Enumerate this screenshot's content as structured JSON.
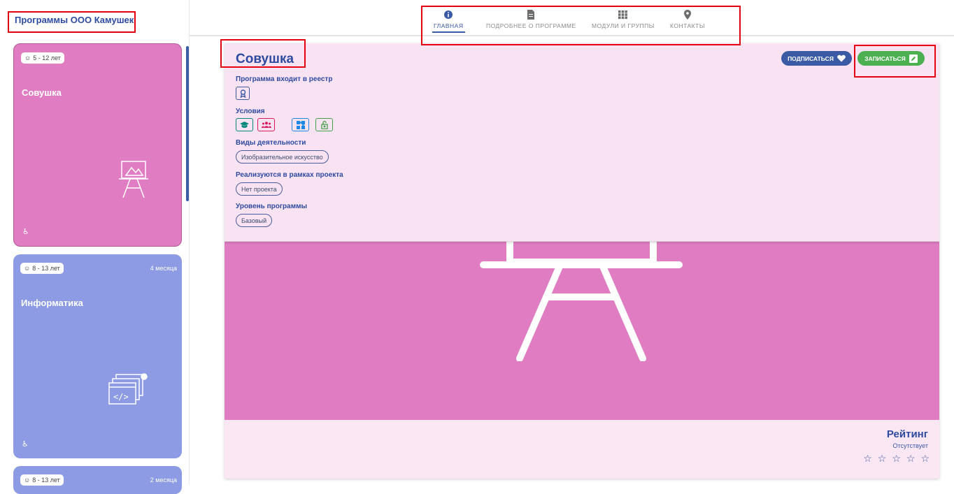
{
  "left": {
    "title": "Программы ООО Камушек",
    "cards": [
      {
        "age": "5 - 12 лет",
        "duration": "",
        "title": "Совушка",
        "color": "#e07dc2"
      },
      {
        "age": "8 - 13 лет",
        "duration": "4 месяца",
        "title": "Информатика",
        "color": "#8c9be3"
      },
      {
        "age": "8 - 13 лет",
        "duration": "2 месяца",
        "title": "",
        "color": "#8c9be3"
      }
    ]
  },
  "nav": {
    "tabs": [
      {
        "label": "ГЛАВНАЯ",
        "icon": "info-icon",
        "active": true
      },
      {
        "label": "ПОДРОБНЕЕ О ПРОГРАММЕ",
        "icon": "document-icon",
        "active": false
      },
      {
        "label": "МОДУЛИ И ГРУППЫ",
        "icon": "grid-icon",
        "active": false
      },
      {
        "label": "КОНТАКТЫ",
        "icon": "location-pin-icon",
        "active": false
      }
    ]
  },
  "program": {
    "title": "Совушка",
    "registry_label": "Программа входит в реестр",
    "conditions_label": "Условия",
    "activities_label": "Виды деятельности",
    "activity": "Изобразительное искусство",
    "project_label": "Реализуются в рамках проекта",
    "project": "Нет проекта",
    "level_label": "Уровень программы",
    "level": "Базовый",
    "subscribe_label": "ПОДПИСАТЬСЯ",
    "enroll_label": "ЗАПИСАТЬСЯ",
    "rating_title": "Рейтинг",
    "rating_status": "Отсутствует",
    "rating_stars": 0,
    "condition_icons": [
      "graduation-cap-icon",
      "group-icon",
      "puzzle-icon",
      "lock-open-icon"
    ],
    "colors": {
      "accent": "#3b5ba5",
      "pink": "#e07dc2",
      "green": "#4caf50"
    }
  }
}
